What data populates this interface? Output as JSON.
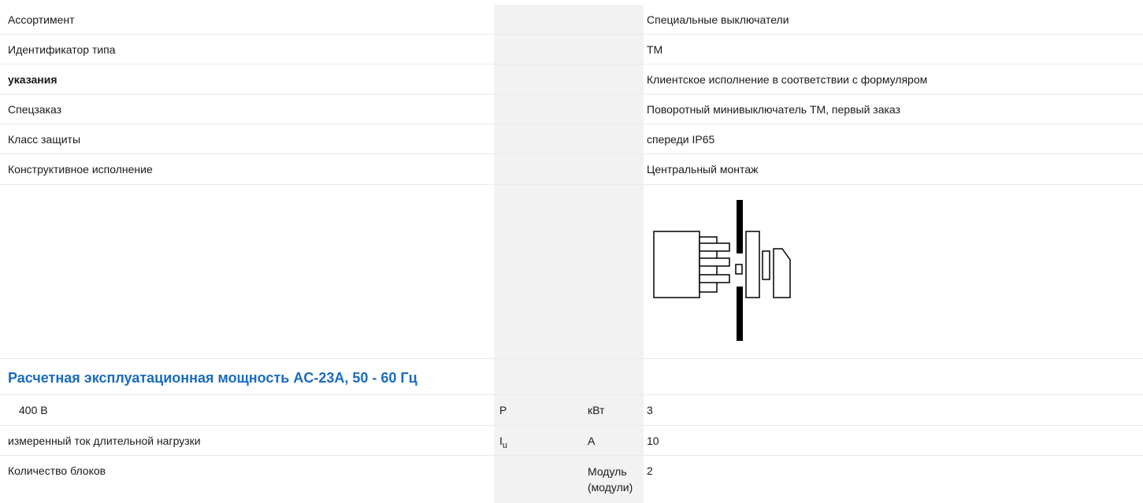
{
  "rows": {
    "assortment": {
      "label": "Ассортимент",
      "value": "Специальные выключатели"
    },
    "type_id": {
      "label": "Идентификатор типа",
      "value": "TM"
    },
    "notes": {
      "label": "указания",
      "value": "Клиентское исполнение в соответствии с формуляром"
    },
    "special_order": {
      "label": "Спецзаказ",
      "value": "Поворотный минивыключатель TM, первый заказ"
    },
    "protection": {
      "label": "Класс защиты",
      "value": "спереди IP65"
    },
    "design": {
      "label": "Конструктивное исполнение",
      "value": "Центральный монтаж"
    }
  },
  "diagram": {
    "icon": "central-mount-switch-diagram"
  },
  "section": {
    "title": "Расчетная эксплуатационная мощность AC-23A, 50 - 60 Гц"
  },
  "power": {
    "label": "400 В",
    "symbol": "P",
    "unit": "кВт",
    "value": "3"
  },
  "current": {
    "label": "измеренный ток длительной нагрузки",
    "symbol": "I",
    "symbol_sub": "u",
    "unit": "A",
    "value": "10"
  },
  "blocks": {
    "label": "Количество блоков",
    "unit": "Модуль (модули)",
    "value": "2"
  },
  "colors": {
    "accent": "#1a6bbf",
    "shade": "#f2f2f2",
    "border": "#eaeaea"
  }
}
